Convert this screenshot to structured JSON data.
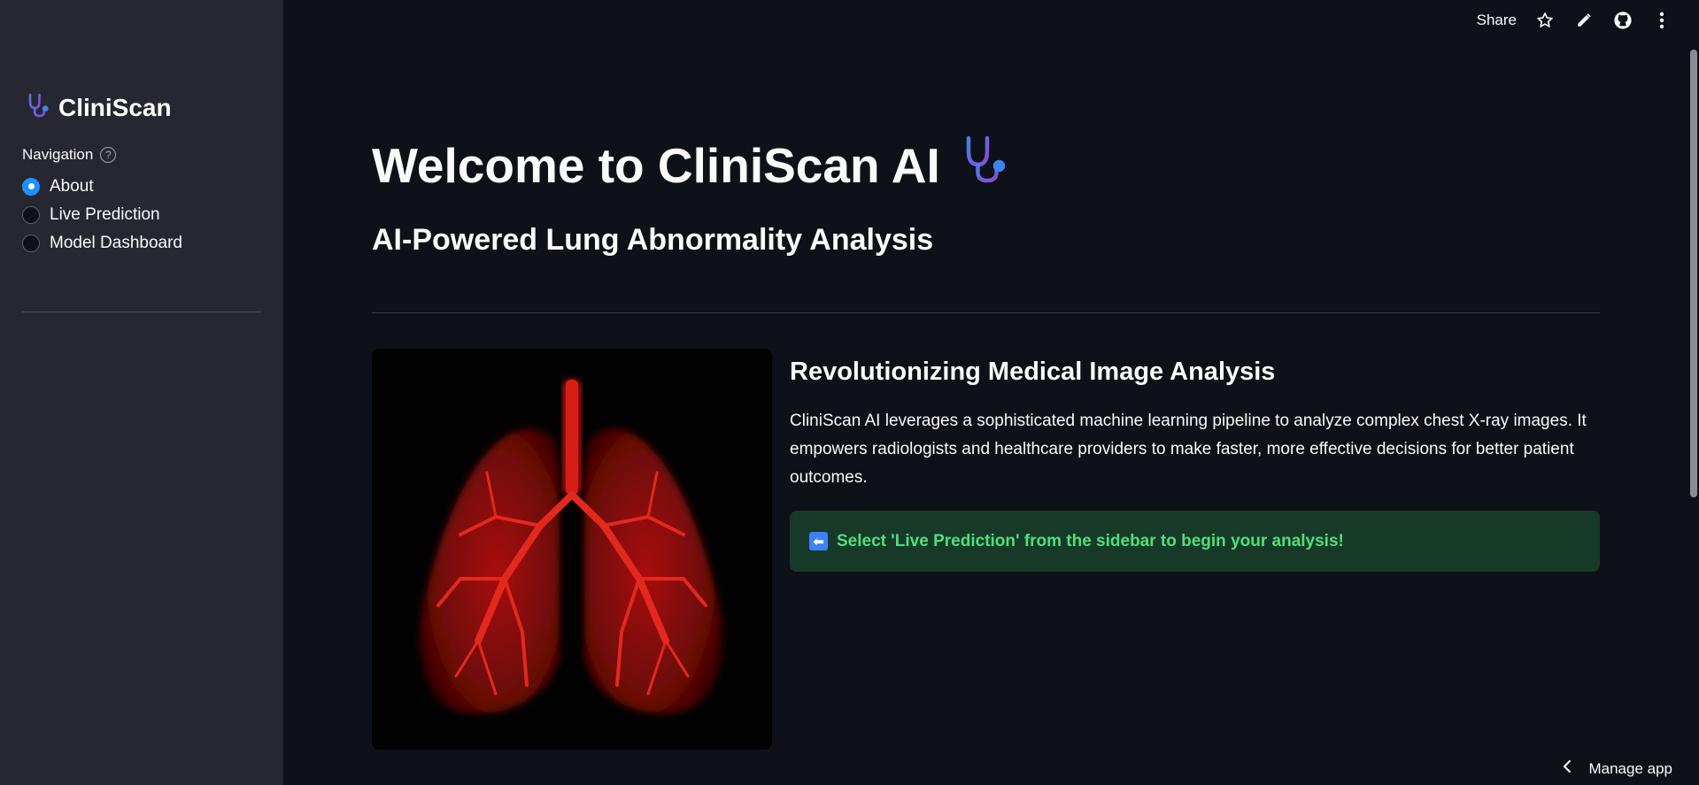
{
  "sidebar": {
    "brand": {
      "icon": "stethoscope-icon",
      "title": "CliniScan"
    },
    "navigation": {
      "label": "Navigation",
      "help_icon": "help-circle-icon",
      "help_glyph": "?",
      "options": [
        {
          "label": "About",
          "selected": true
        },
        {
          "label": "Live Prediction",
          "selected": false
        },
        {
          "label": "Model Dashboard",
          "selected": false
        }
      ]
    }
  },
  "toolbar": {
    "share_label": "Share",
    "icons": [
      "star-icon",
      "pencil-icon",
      "github-icon",
      "more-vertical-icon"
    ]
  },
  "main": {
    "title": "Welcome to CliniScan AI",
    "title_icon": "stethoscope-icon",
    "subtitle": "AI-Powered Lung Abnormality Analysis",
    "image": "lung-illustration",
    "section_title": "Revolutionizing Medical Image Analysis",
    "description": "CliniScan AI leverages a sophisticated machine learning pipeline to analyze complex chest X-ray images. It empowers radiologists and healthcare providers to make faster, more effective decisions for better patient outcomes.",
    "alert": {
      "icon": "arrow-left-icon",
      "glyph": "⬅",
      "text": "Select 'Live Prediction' from the sidebar to begin your analysis!"
    }
  },
  "footer": {
    "manage_label": "Manage app",
    "icon": "chevron-left-icon"
  },
  "colors": {
    "background": "#0e1117",
    "sidebar": "#262730",
    "accent": "#1e90ff",
    "alert_bg": "#173928",
    "alert_text": "#4ee07a"
  }
}
